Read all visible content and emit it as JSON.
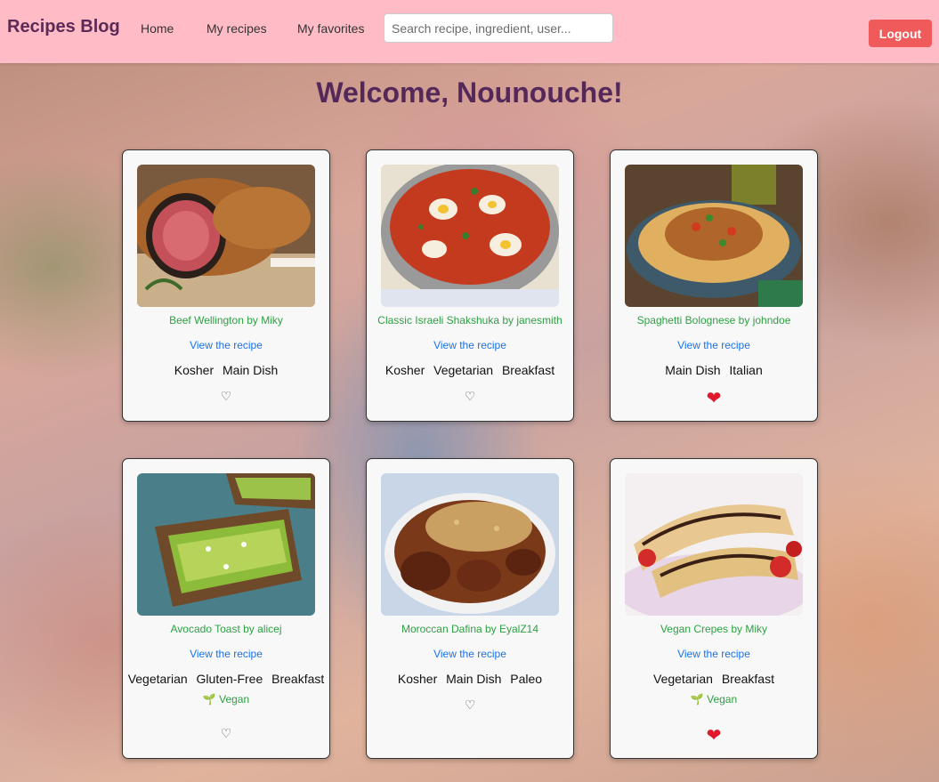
{
  "navbar": {
    "brand": "Recipes Blog",
    "links": [
      "Home",
      "My recipes",
      "My favorites"
    ],
    "search_placeholder": "Search recipe, ingredient, user...",
    "logout_label": "Logout"
  },
  "welcome": "Welcome, Nounouche!",
  "recipes": [
    {
      "title": "Beef Wellington by Miky",
      "view": "View the recipe",
      "tags": [
        "Kosher",
        "Main Dish"
      ],
      "vegan": null,
      "favorite": false,
      "heart": "♡"
    },
    {
      "title": "Classic Israeli Shakshuka by janesmith",
      "view": "View the recipe",
      "tags": [
        "Kosher",
        "Vegetarian",
        "Breakfast"
      ],
      "vegan": null,
      "favorite": false,
      "heart": "♡"
    },
    {
      "title": "Spaghetti Bolognese by johndoe",
      "view": "View the recipe",
      "tags": [
        "Main Dish",
        "Italian"
      ],
      "vegan": null,
      "favorite": true,
      "heart": "❤"
    },
    {
      "title": "Avocado Toast by alicej",
      "view": "View the recipe",
      "tags": [
        "Vegetarian",
        "Gluten-Free",
        "Breakfast"
      ],
      "vegan": "🌱 Vegan",
      "favorite": false,
      "heart": "♡"
    },
    {
      "title": "Moroccan Dafina by EyalZ14",
      "view": "View the recipe",
      "tags": [
        "Kosher",
        "Main Dish",
        "Paleo"
      ],
      "vegan": null,
      "favorite": false,
      "heart": "♡"
    },
    {
      "title": "Vegan Crepes by Miky",
      "view": "View the recipe",
      "tags": [
        "Vegetarian",
        "Breakfast"
      ],
      "vegan": "🌱 Vegan",
      "favorite": true,
      "heart": "❤"
    }
  ],
  "colors": {
    "navbar_bg": "#ffbcc6",
    "brand": "#5b2a55",
    "logout_bg": "#f05a5a",
    "recipe_title": "#2ea043",
    "link": "#1a73e8",
    "heart_filled": "#e0182b"
  }
}
